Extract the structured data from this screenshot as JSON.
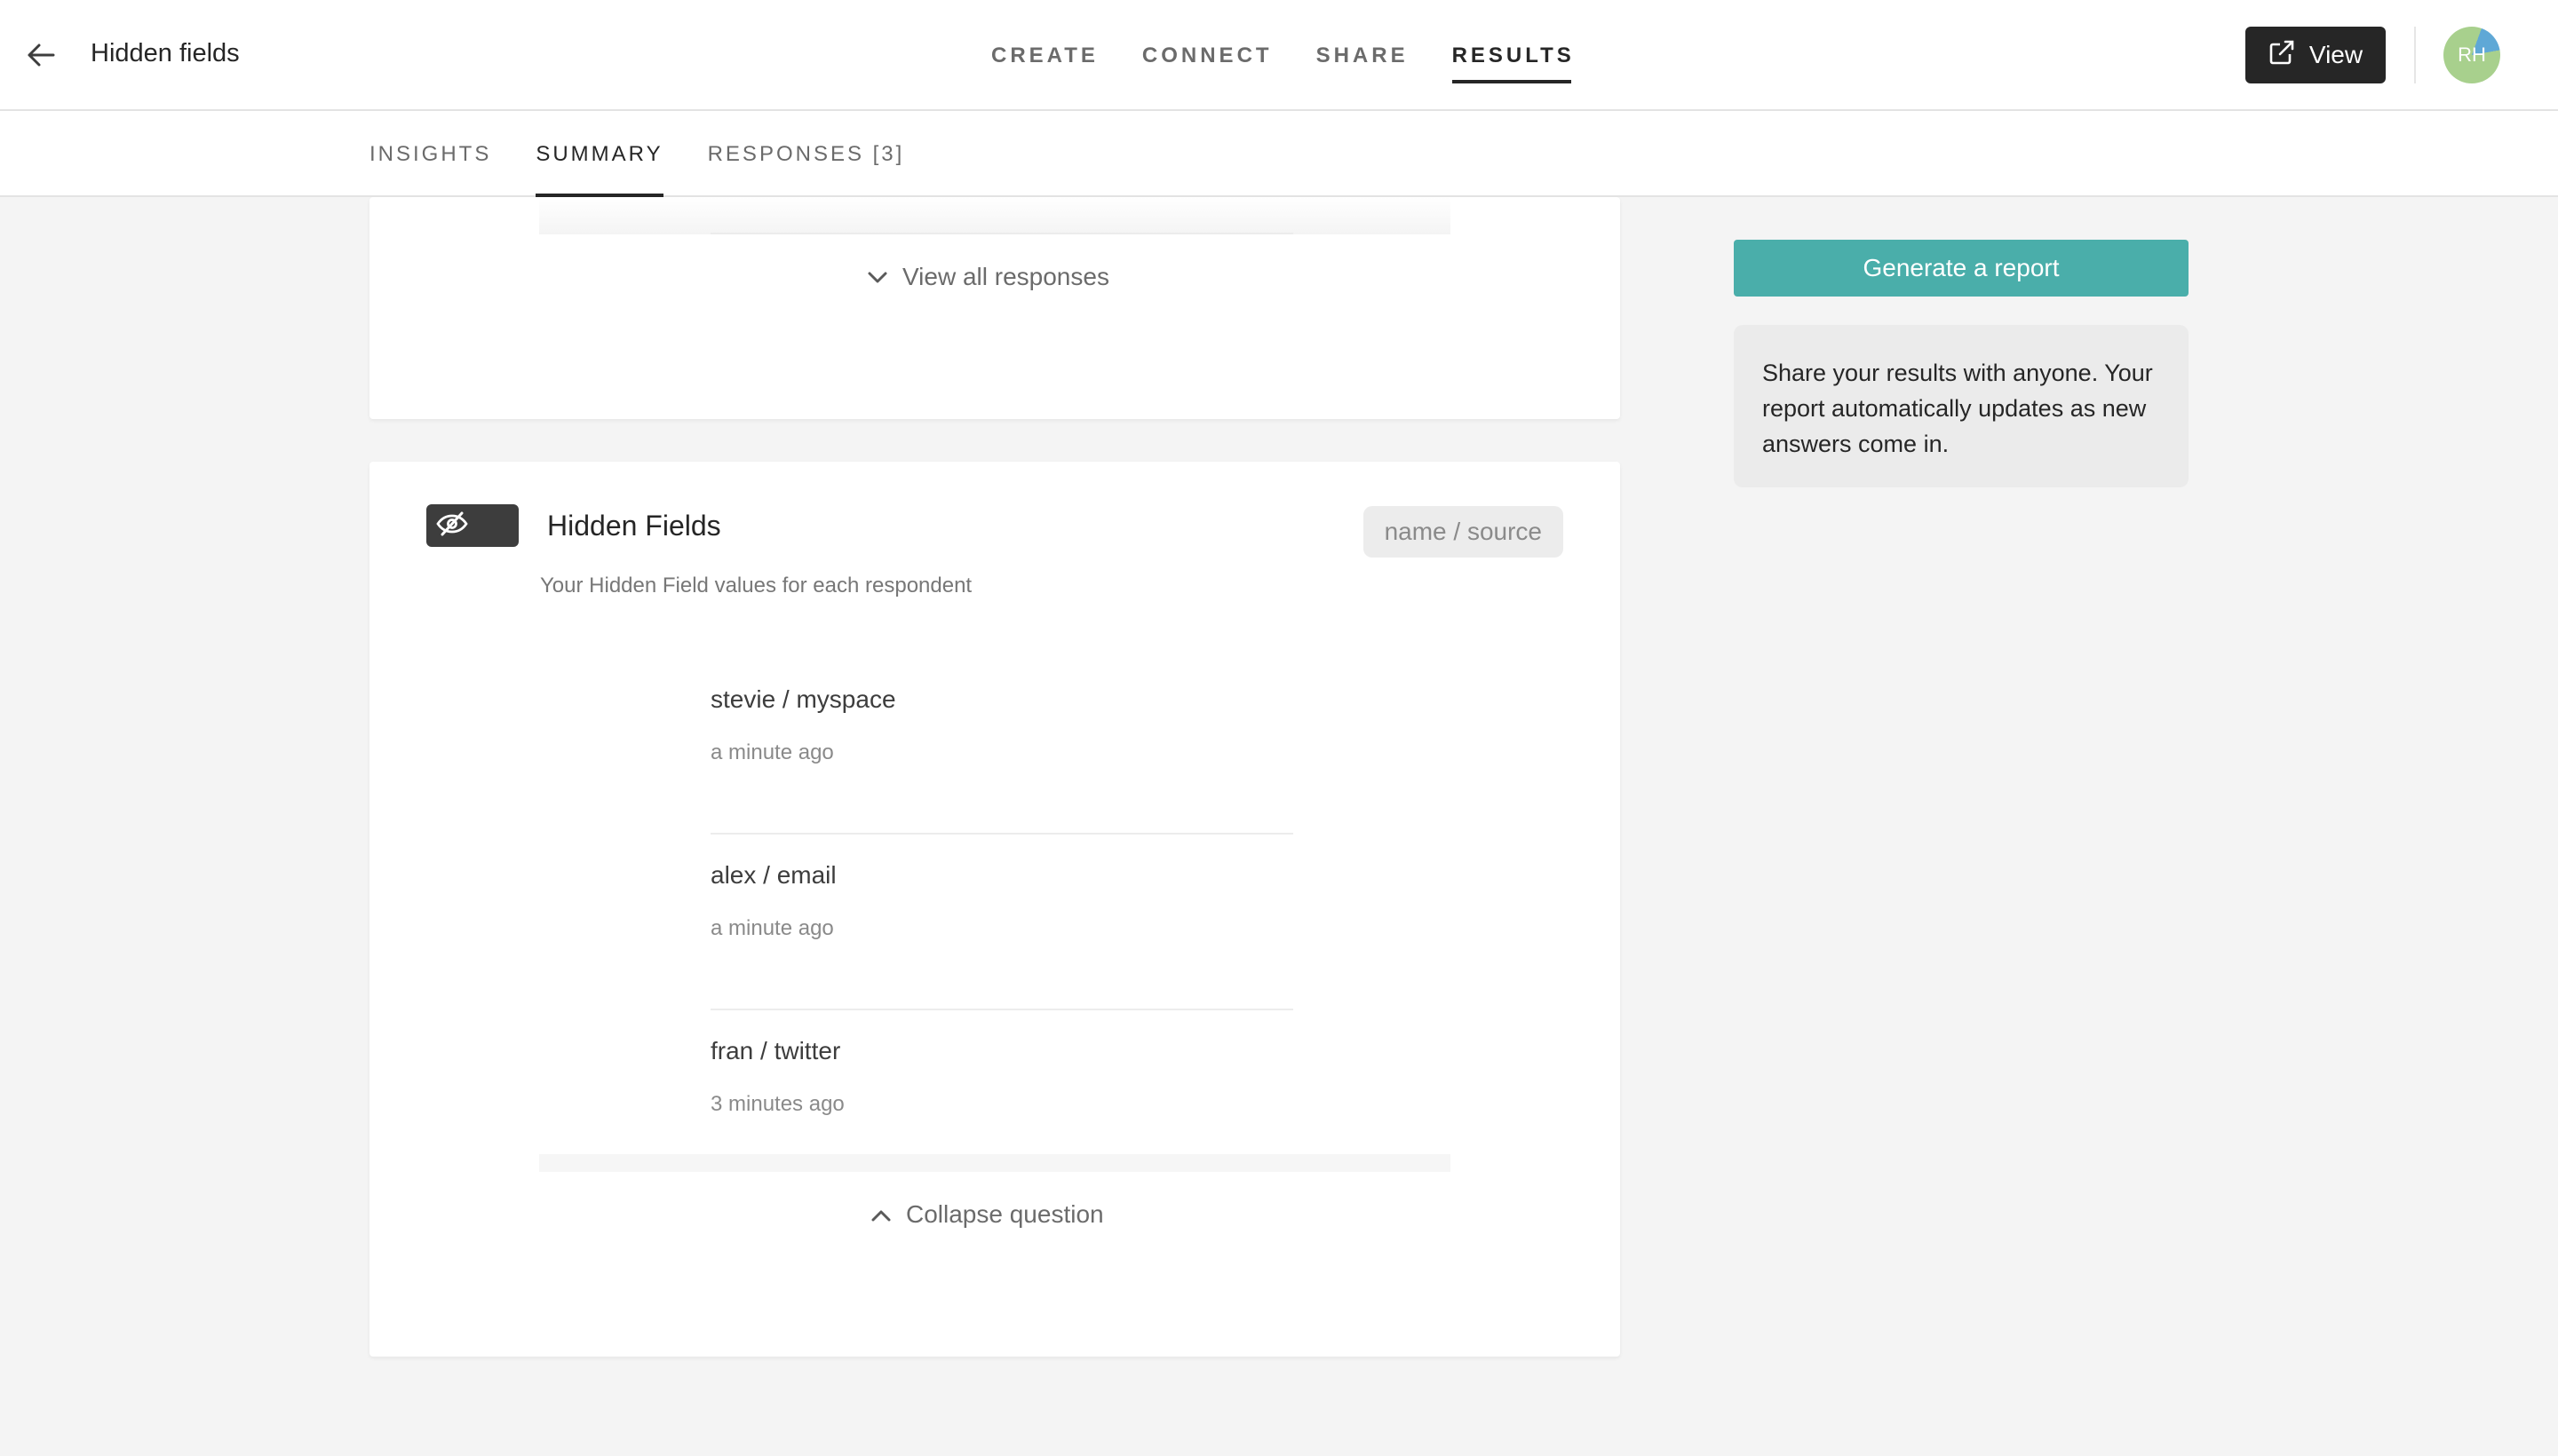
{
  "header": {
    "title": "Hidden fields",
    "nav": [
      {
        "label": "CREATE",
        "active": false
      },
      {
        "label": "CONNECT",
        "active": false
      },
      {
        "label": "SHARE",
        "active": false
      },
      {
        "label": "RESULTS",
        "active": true
      }
    ],
    "view_label": "View",
    "avatar_initials": "RH"
  },
  "subnav": {
    "items": [
      {
        "label": "INSIGHTS",
        "active": false
      },
      {
        "label": "SUMMARY",
        "active": true
      },
      {
        "label": "RESPONSES [3]",
        "active": false
      }
    ]
  },
  "prev_card": {
    "view_all_label": "View all responses"
  },
  "hidden_fields_card": {
    "title": "Hidden Fields",
    "field_names": "name / source",
    "description": "Your Hidden Field values for each respondent",
    "responses": [
      {
        "value": "stevie / myspace",
        "time": "a minute ago"
      },
      {
        "value": "alex / email",
        "time": "a minute ago"
      },
      {
        "value": "fran / twitter",
        "time": "3 minutes ago"
      }
    ],
    "collapse_label": "Collapse question"
  },
  "sidebar": {
    "report_button_label": "Generate a report",
    "report_info": "Share your results with anyone. Your report automatically updates as new answers come in."
  },
  "colors": {
    "accent": "#4aaeaa",
    "dark": "#262626",
    "background": "#f4f4f4"
  }
}
